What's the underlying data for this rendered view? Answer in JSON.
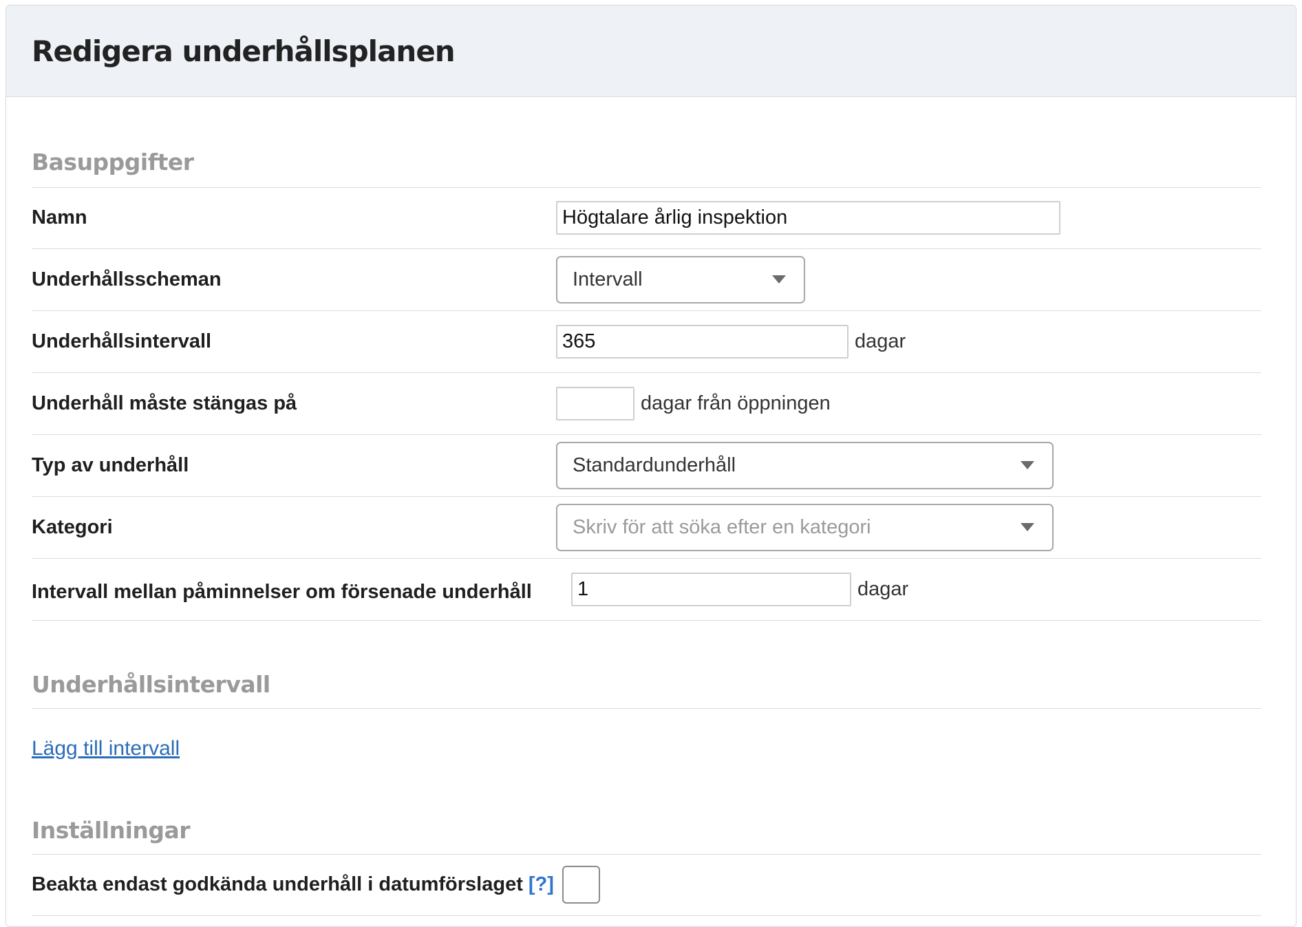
{
  "header": {
    "title": "Redigera underhållsplanen"
  },
  "sections": {
    "basic": "Basuppgifter",
    "intervals": "Underhållsintervall",
    "settings": "Inställningar"
  },
  "fields": {
    "name": {
      "label": "Namn",
      "value": "Högtalare årlig inspektion"
    },
    "schedule": {
      "label": "Underhållsscheman",
      "selected": "Intervall"
    },
    "interval": {
      "label": "Underhållsintervall",
      "value": "365",
      "unit": "dagar"
    },
    "close_after": {
      "label": "Underhåll måste stängas på",
      "value": "",
      "unit": "dagar från öppningen"
    },
    "type": {
      "label": "Typ av underhåll",
      "selected": "Standardunderhåll"
    },
    "category": {
      "label": "Kategori",
      "placeholder": "Skriv för att söka efter en kategori"
    },
    "reminder": {
      "label": "Intervall mellan påminnelser om försenade underhåll",
      "value": "1",
      "unit": "dagar"
    }
  },
  "intervals": {
    "add_link": "Lägg till intervall"
  },
  "settings": {
    "approved_only": {
      "label": "Beakta endast godkända underhåll i datumförslaget",
      "help": "[?]",
      "checked": false
    }
  },
  "colors": {
    "header_bg": "#eef2f7",
    "link": "#2b6cb8",
    "section_heading": "#9a9a9a"
  }
}
